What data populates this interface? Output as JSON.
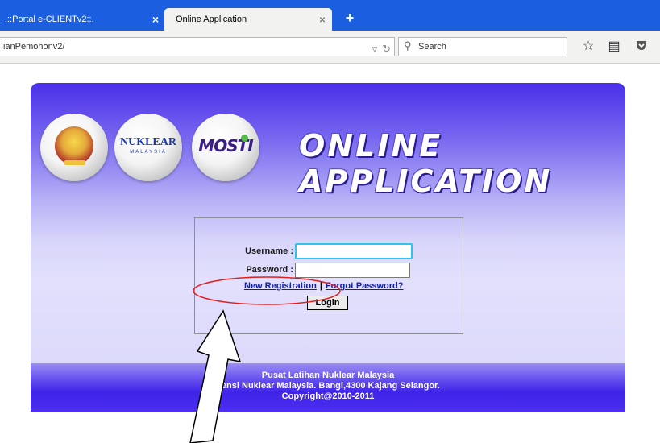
{
  "browser": {
    "tabs": [
      {
        "label": ".::Portal e-CLIENTv2::.",
        "active": false
      },
      {
        "label": "Online Application",
        "active": true
      }
    ],
    "new_tab_label": "+",
    "close_glyph": "×",
    "url": "ianPemohonv2/",
    "search_placeholder": "Search",
    "icons": [
      "dropdown-arrow-icon",
      "reload-icon",
      "search-icon",
      "bookmark-star-icon",
      "reading-list-icon",
      "pocket-icon"
    ]
  },
  "page": {
    "title": "ONLINE APPLICATION",
    "logos": [
      {
        "name": "malaysia-coat-of-arms-icon"
      },
      {
        "name": "nuklear-malaysia-logo",
        "text_main": "NUKLEAR",
        "text_sub": "MALAYSIA"
      },
      {
        "name": "mosti-logo",
        "text": "MOSTI"
      }
    ],
    "login": {
      "username_label": "Username :",
      "password_label": "Password :",
      "username_value": "",
      "password_value": "",
      "new_registration": "New Registration",
      "separator": "|",
      "forgot_password": "Forgot Password?",
      "login_button": "Login"
    },
    "footer": {
      "line1": "Pusat Latihan Nuklear Malaysia",
      "line2": "gensi Nuklear Malaysia. Bangi,4300 Kajang Selangor.",
      "line3": "Copyright@2010-2011"
    }
  },
  "colors": {
    "tab_strip": "#1b5fe0",
    "header_gradient_top": "#4a2fe8",
    "footer_band": "#4c2ff0",
    "link": "#1020a8",
    "annotation": "#e02020"
  }
}
